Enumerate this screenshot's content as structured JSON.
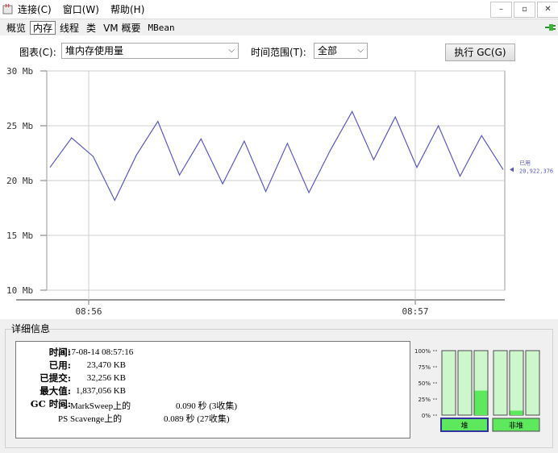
{
  "menu": {
    "items": [
      "连接(C)",
      "窗口(W)",
      "帮助(H)"
    ]
  },
  "window_controls": {
    "minimize": "–",
    "restore": "▫",
    "close": "✕"
  },
  "tabs": [
    "概览",
    "内存",
    "线程",
    "类",
    "VM 概要",
    "MBean"
  ],
  "toolbar": {
    "chart_label": "图表(C):",
    "chart_select": "堆内存使用量",
    "range_label": "时间范围(T):",
    "range_select": "全部",
    "gc_button": "执行 GC(G)"
  },
  "chart_data": {
    "type": "line",
    "ylim": [
      10,
      30
    ],
    "y_ticks": [
      "30 Mb",
      "25 Mb",
      "20 Mb",
      "15 Mb",
      "10 Mb"
    ],
    "x_ticks": [
      "08:56",
      "08:57"
    ],
    "series": [
      {
        "name": "已用",
        "values": [
          21.2,
          23.9,
          22.2,
          18.2,
          22.3,
          25.4,
          20.5,
          23.8,
          19.7,
          23.6,
          19.0,
          23.4,
          18.9,
          22.8,
          26.3,
          21.9,
          25.8,
          21.2,
          25.0,
          20.4,
          24.1,
          21.0
        ],
        "last_value": "20,922,376"
      }
    ]
  },
  "details": {
    "title": "详细信息",
    "time_label": "时间:",
    "time_value": "2017-08-14 08:57:16",
    "used_label": "已用:",
    "used_value": "23,470 KB",
    "committed_label": "已提交:",
    "committed_value": "32,256 KB",
    "max_label": "最大值:",
    "max_value": "1,837,056 KB",
    "gc_label": "GC 时间:",
    "gc_rows": [
      {
        "name": "PS MarkSweep上的",
        "time": "0.090 秒 (3收集)"
      },
      {
        "name": "PS Scavenge上的",
        "time": "0.089 秒 (27收集)"
      }
    ]
  },
  "memory_pools": {
    "ticks": [
      "100%",
      "75%",
      "50%",
      "25%",
      "0%"
    ],
    "heap_fill": [
      0.0,
      0.0,
      0.38
    ],
    "nonheap_fill": [
      0.0,
      0.07,
      0.0
    ],
    "heap_label": "堆",
    "nonheap_label": "非堆",
    "colors": {
      "used": "#5ee85e",
      "free": "#cdf6cd",
      "border": "#4a4a4a"
    }
  }
}
